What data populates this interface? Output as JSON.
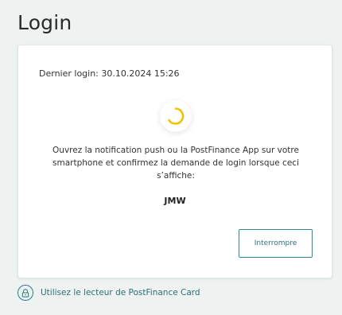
{
  "page": {
    "title": "Login"
  },
  "card": {
    "last_login": "Dernier login: 30.10.2024 15:26",
    "instructions": "Ouvrez la notification push ou la PostFinance App sur votre smartphone et confirmez la demande de login lorsque ceci s’affiche:",
    "code": "JMW",
    "cancel_label": "Interrompre",
    "spinner_icon": "loading-spinner-icon"
  },
  "footer": {
    "card_reader_link": "Utilisez le lecteur de PostFinance Card",
    "lock_icon": "lock-icon"
  },
  "colors": {
    "background": "#eef3f2",
    "accent_teal": "#2e6f76",
    "spinner_yellow": "#f2c200"
  }
}
